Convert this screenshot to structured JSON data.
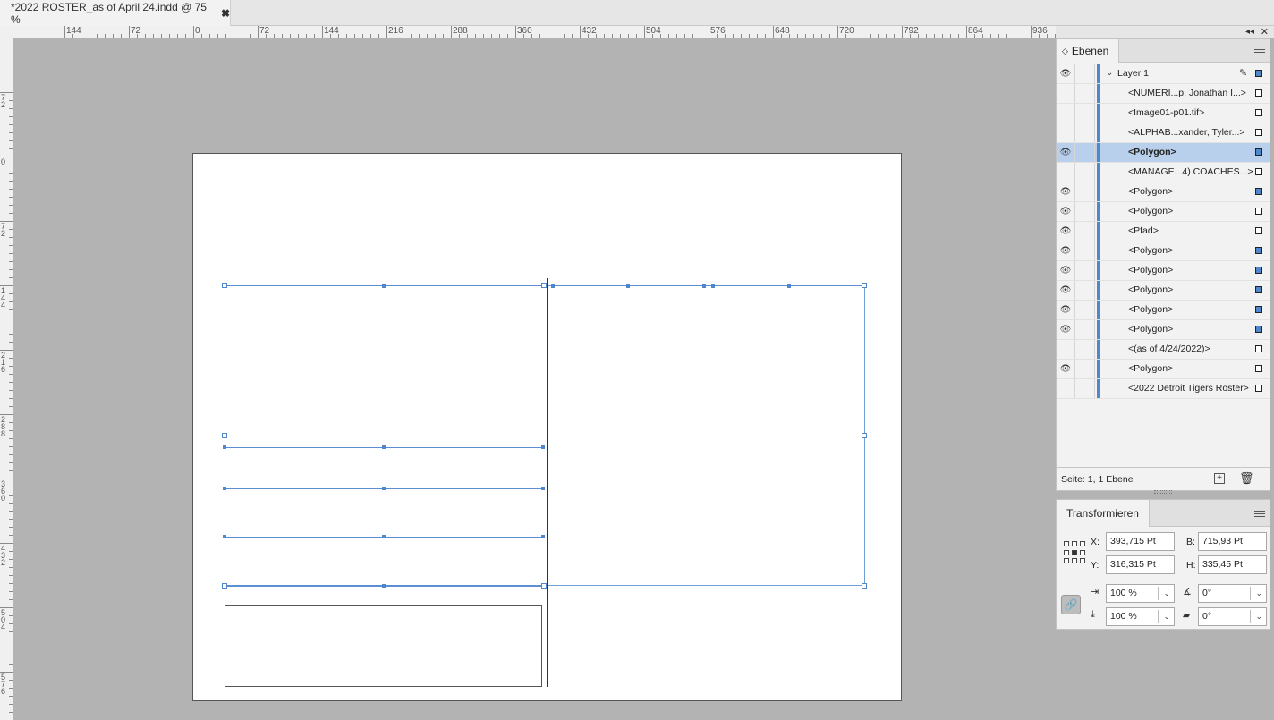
{
  "document_tab": {
    "title": "*2022 ROSTER_as of April 24.indd @ 75 %",
    "close_glyph": "✖"
  },
  "rulers": {
    "top_labels": [
      "144",
      "72",
      "0",
      "72",
      "144",
      "216",
      "288",
      "360",
      "432",
      "504",
      "576",
      "648",
      "720",
      "792",
      "864",
      "936"
    ],
    "left_labels": [
      "72",
      "0",
      "72",
      "144",
      "216",
      "288",
      "360",
      "432",
      "504",
      "576"
    ]
  },
  "panel_strip": {
    "collapse_glyph": "◂◂",
    "close_glyph": "✕"
  },
  "layers_panel": {
    "tab_label": "Ebenen",
    "icon_color": "#4f86cc",
    "rows": [
      {
        "label": "Layer 1",
        "eye": true,
        "type": "layer",
        "swatch": "filled"
      },
      {
        "label": "<NUMERI...p, Jonathan I...>",
        "eye": false,
        "swatch": "empty"
      },
      {
        "label": "<Image01-p01.tif>",
        "eye": false,
        "swatch": "empty"
      },
      {
        "label": "<ALPHAB...xander, Tyler...>",
        "eye": false,
        "swatch": "empty"
      },
      {
        "label": "<Polygon>",
        "eye": true,
        "swatch": "filled",
        "selected": true
      },
      {
        "label": "<MANAGE...4) COACHES...>",
        "eye": false,
        "swatch": "empty"
      },
      {
        "label": "<Polygon>",
        "eye": true,
        "swatch": "filled"
      },
      {
        "label": "<Polygon>",
        "eye": true,
        "swatch": "empty"
      },
      {
        "label": "<Pfad>",
        "eye": true,
        "swatch": "empty"
      },
      {
        "label": "<Polygon>",
        "eye": true,
        "swatch": "filled"
      },
      {
        "label": "<Polygon>",
        "eye": true,
        "swatch": "filled"
      },
      {
        "label": "<Polygon>",
        "eye": true,
        "swatch": "filled"
      },
      {
        "label": "<Polygon>",
        "eye": true,
        "swatch": "filled"
      },
      {
        "label": "<Polygon>",
        "eye": true,
        "swatch": "filled"
      },
      {
        "label": "<(as of 4/24/2022)>",
        "eye": false,
        "swatch": "empty"
      },
      {
        "label": "<Polygon>",
        "eye": true,
        "swatch": "empty"
      },
      {
        "label": "<2022 Detroit Tigers Roster>",
        "eye": false,
        "swatch": "empty"
      }
    ],
    "footer": "Seite: 1, 1 Ebene"
  },
  "transform_panel": {
    "tab_label": "Transformieren",
    "x_label": "X:",
    "x_value": "393,715 Pt",
    "y_label": "Y:",
    "y_value": "316,315 Pt",
    "w_label": "B:",
    "w_value": "715,93 Pt",
    "h_label": "H:",
    "h_value": "335,45 Pt",
    "scale_x": "100 %",
    "scale_y": "100 %",
    "rotation": "0°",
    "shear": "0°"
  }
}
